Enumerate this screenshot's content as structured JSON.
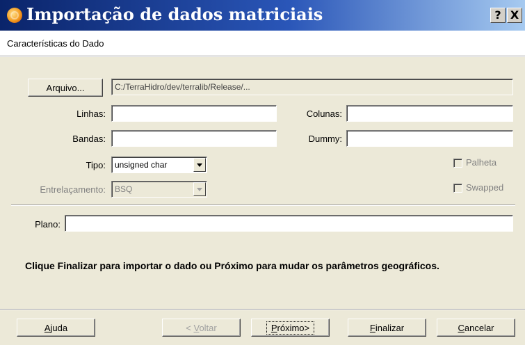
{
  "window": {
    "title": "Importação de dados matriciais",
    "help_label": "?",
    "close_label": "X",
    "subtitle": "Características do Dado"
  },
  "file": {
    "button_label": "Arquivo...",
    "path": "C:/TerraHidro/dev/terralib/Release/..."
  },
  "fields": {
    "linhas_label": "Linhas:",
    "linhas_value": "",
    "colunas_label": "Colunas:",
    "colunas_value": "",
    "bandas_label": "Bandas:",
    "bandas_value": "",
    "dummy_label": "Dummy:",
    "dummy_value": "",
    "tipo_label": "Tipo:",
    "tipo_value": "unsigned char",
    "entrelacamento_label": "Entrelaçamento:",
    "entrelacamento_value": "BSQ",
    "palheta_label": "Palheta",
    "swapped_label": "Swapped",
    "plano_label": "Plano:",
    "plano_value": ""
  },
  "message": "Clique Finalizar para importar o dado ou Próximo para mudar os parâmetros geográficos.",
  "buttons": {
    "ajuda_u": "A",
    "ajuda_rest": "juda",
    "voltar_pre": "< ",
    "voltar_u": "V",
    "voltar_rest": "oltar",
    "proximo_u": "P",
    "proximo_rest": "róximo>",
    "finalizar_u": "F",
    "finalizar_rest": "inalizar",
    "cancelar_u": "C",
    "cancelar_rest": "ancelar"
  },
  "colors": {
    "title_gradient_start": "#0a246a",
    "title_gradient_end": "#a6caf0",
    "dialog_bg": "#ece9d8"
  }
}
